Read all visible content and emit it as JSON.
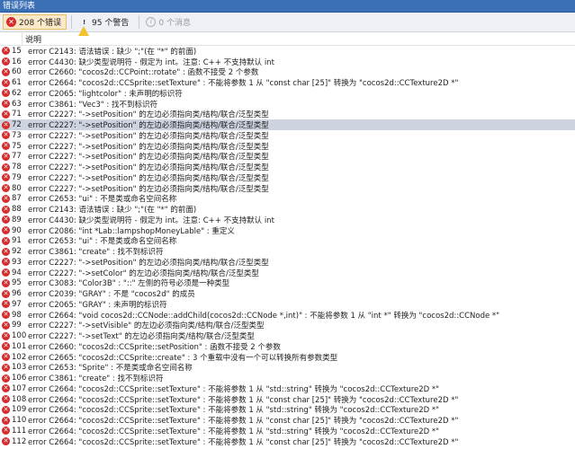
{
  "window": {
    "title": "错误列表"
  },
  "toolbar": {
    "errors_label": "208 个错误",
    "warnings_label": "95 个警告",
    "messages_label": "0 个消息"
  },
  "header": {
    "description": "说明"
  },
  "rows": [
    {
      "num": "15",
      "msg": "error C2143: 语法错误 : 缺少 \";\"(在 \"*\" 的前面)"
    },
    {
      "num": "16",
      "msg": "error C4430: 缺少类型说明符 - 假定为 int。注意: C++ 不支持默认 int"
    },
    {
      "num": "60",
      "msg": "error C2660: \"cocos2d::CCPoint::rotate\" : 函数不接受 2 个参数"
    },
    {
      "num": "61",
      "msg": "error C2664: \"cocos2d::CCSprite::setTexture\" : 不能将参数 1 从 \"const char [25]\" 转换为 \"cocos2d::CCTexture2D *\""
    },
    {
      "num": "62",
      "msg": "error C2065: \"lightcolor\" : 未声明的标识符"
    },
    {
      "num": "63",
      "msg": "error C3861: \"Vec3\" : 找不到标识符"
    },
    {
      "num": "71",
      "msg": "error C2227: \"->setPosition\" 的左边必须指向类/结构/联合/泛型类型"
    },
    {
      "num": "72",
      "msg": "error C2227: \"->setPosition\" 的左边必须指向类/结构/联合/泛型类型"
    },
    {
      "num": "73",
      "msg": "error C2227: \"->setPosition\" 的左边必须指向类/结构/联合/泛型类型"
    },
    {
      "num": "75",
      "msg": "error C2227: \"->setPosition\" 的左边必须指向类/结构/联合/泛型类型"
    },
    {
      "num": "77",
      "msg": "error C2227: \"->setPosition\" 的左边必须指向类/结构/联合/泛型类型"
    },
    {
      "num": "78",
      "msg": "error C2227: \"->setPosition\" 的左边必须指向类/结构/联合/泛型类型"
    },
    {
      "num": "79",
      "msg": "error C2227: \"->setPosition\" 的左边必须指向类/结构/联合/泛型类型"
    },
    {
      "num": "80",
      "msg": "error C2227: \"->setPosition\" 的左边必须指向类/结构/联合/泛型类型"
    },
    {
      "num": "87",
      "msg": "error C2653: \"ui\" : 不是类或命名空间名称"
    },
    {
      "num": "88",
      "msg": "error C2143: 语法错误 : 缺少 \";\"(在 \"*\" 的前面)"
    },
    {
      "num": "89",
      "msg": "error C4430: 缺少类型说明符 - 假定为 int。注意: C++ 不支持默认 int"
    },
    {
      "num": "90",
      "msg": "error C2086: \"int *Lab::lampshopMoneyLable\" : 重定义"
    },
    {
      "num": "91",
      "msg": "error C2653: \"ui\" : 不是类或命名空间名称"
    },
    {
      "num": "92",
      "msg": "error C3861: \"create\" : 找不到标识符"
    },
    {
      "num": "93",
      "msg": "error C2227: \"->setPosition\" 的左边必须指向类/结构/联合/泛型类型"
    },
    {
      "num": "94",
      "msg": "error C2227: \"->setColor\" 的左边必须指向类/结构/联合/泛型类型"
    },
    {
      "num": "95",
      "msg": "error C3083: \"Color3B\" : \"::\" 左侧的符号必须是一种类型"
    },
    {
      "num": "96",
      "msg": "error C2039: \"GRAY\" : 不是 \"cocos2d\" 的成员"
    },
    {
      "num": "97",
      "msg": "error C2065: \"GRAY\" : 未声明的标识符"
    },
    {
      "num": "98",
      "msg": "error C2664: \"void cocos2d::CCNode::addChild(cocos2d::CCNode *,int)\" : 不能将参数 1 从 \"int *\" 转换为 \"cocos2d::CCNode *\""
    },
    {
      "num": "99",
      "msg": "error C2227: \"->setVisible\" 的左边必须指向类/结构/联合/泛型类型"
    },
    {
      "num": "100",
      "msg": "error C2227: \"->setText\" 的左边必须指向类/结构/联合/泛型类型"
    },
    {
      "num": "101",
      "msg": "error C2660: \"cocos2d::CCSprite::setPosition\" : 函数不接受 2 个参数"
    },
    {
      "num": "102",
      "msg": "error C2665: \"cocos2d::CCSprite::create\" : 3 个重载中没有一个可以转换所有参数类型"
    },
    {
      "num": "103",
      "msg": "error C2653: \"Sprite\" : 不是类或命名空间名称"
    },
    {
      "num": "106",
      "msg": "error C3861: \"create\" : 找不到标识符"
    },
    {
      "num": "107",
      "msg": "error C2664: \"cocos2d::CCSprite::setTexture\" : 不能将参数 1 从 \"std::string\" 转换为 \"cocos2d::CCTexture2D *\""
    },
    {
      "num": "108",
      "msg": "error C2664: \"cocos2d::CCSprite::setTexture\" : 不能将参数 1 从 \"const char [25]\" 转换为 \"cocos2d::CCTexture2D *\""
    },
    {
      "num": "109",
      "msg": "error C2664: \"cocos2d::CCSprite::setTexture\" : 不能将参数 1 从 \"std::string\" 转换为 \"cocos2d::CCTexture2D *\""
    },
    {
      "num": "110",
      "msg": "error C2664: \"cocos2d::CCSprite::setTexture\" : 不能将参数 1 从 \"const char [25]\" 转换为 \"cocos2d::CCTexture2D *\""
    },
    {
      "num": "111",
      "msg": "error C2664: \"cocos2d::CCSprite::setTexture\" : 不能将参数 1 从 \"std::string\" 转换为 \"cocos2d::CCTexture2D *\""
    },
    {
      "num": "112",
      "msg": "error C2664: \"cocos2d::CCSprite::setTexture\" : 不能将参数 1 从 \"const char [25]\" 转换为 \"cocos2d::CCTexture2D *\""
    }
  ],
  "selected_row": "72",
  "colors": {
    "titlebar": "#3b6fb6",
    "error_icon": "#d52b2b",
    "warning_icon": "#f2c12e",
    "selection": "#cdd3df",
    "toggle_pressed": "#fbe8c8"
  },
  "icons": {
    "errors_toggle": "error-icon",
    "warnings_toggle": "warning-icon",
    "messages_toggle": "info-icon",
    "row": "error-icon"
  }
}
